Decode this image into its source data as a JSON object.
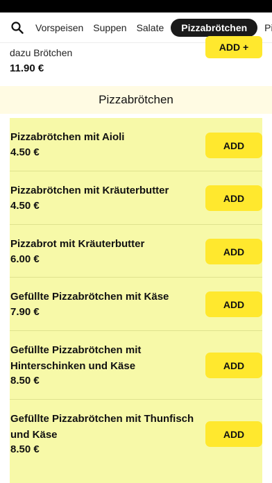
{
  "nav": {
    "tabs": [
      {
        "label": "Vorspeisen"
      },
      {
        "label": "Suppen"
      },
      {
        "label": "Salate"
      },
      {
        "label": "Pizzabrötchen",
        "active": true
      },
      {
        "label": "Pizza"
      }
    ]
  },
  "prev_item": {
    "description": "dazu Brötchen",
    "price": "11.90 €",
    "add_label": "ADD +"
  },
  "section": {
    "title": "Pizzabrötchen"
  },
  "items": [
    {
      "name": "Pizzabrötchen mit Aioli",
      "price": "4.50 €",
      "add_label": "ADD"
    },
    {
      "name": "Pizzabrötchen mit Kräuterbutter",
      "price": "4.50 €",
      "add_label": "ADD"
    },
    {
      "name": "Pizzabrot mit Kräuterbutter",
      "price": "6.00 €",
      "add_label": "ADD"
    },
    {
      "name": "Gefüllte Pizzabrötchen mit Käse",
      "price": "7.90 €",
      "add_label": "ADD"
    },
    {
      "name": "Gefüllte Pizzabrötchen mit Hinterschinken und Käse",
      "price": "8.50 €",
      "add_label": "ADD"
    },
    {
      "name": "Gefüllte Pizzabrötchen mit Thunfisch und Käse",
      "price": "8.50 €",
      "add_label": "ADD"
    }
  ],
  "colors": {
    "accent": "#ffe82e",
    "list_bg": "#f7f9a8",
    "section_bg": "#fffbe3",
    "active_tab_bg": "#1a1a1a"
  },
  "icons": {
    "search": "search-icon"
  }
}
